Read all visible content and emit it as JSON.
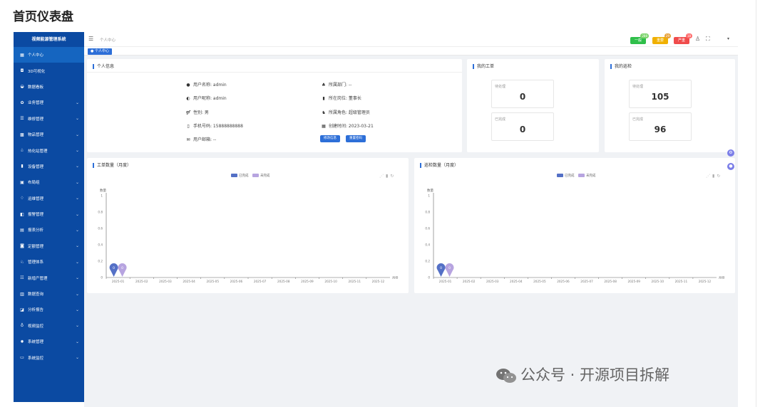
{
  "page": {
    "heading": "首页仪表盘"
  },
  "sidebar": {
    "brand": "视频能源管理系统",
    "items": [
      {
        "label": "个人中心",
        "icon": "grid-icon",
        "glyph": "▦",
        "expandable": false,
        "active": true
      },
      {
        "label": "3D可视化",
        "icon": "cube-icon",
        "glyph": "◘",
        "expandable": false,
        "active": false
      },
      {
        "label": "数据看板",
        "icon": "dashboard-icon",
        "glyph": "◒",
        "expandable": false,
        "active": false
      },
      {
        "label": "业务管理",
        "icon": "briefcase-icon",
        "glyph": "✿",
        "expandable": true,
        "active": false
      },
      {
        "label": "维修管理",
        "icon": "wrench-icon",
        "glyph": "☰",
        "expandable": true,
        "active": false
      },
      {
        "label": "物品管理",
        "icon": "box-icon",
        "glyph": "▩",
        "expandable": true,
        "active": false
      },
      {
        "label": "热化站管理",
        "icon": "station-icon",
        "glyph": "♧",
        "expandable": true,
        "active": false
      },
      {
        "label": "设备管理",
        "icon": "bar-chart-icon",
        "glyph": "▮",
        "expandable": true,
        "active": false
      },
      {
        "label": "布局组",
        "icon": "layout-icon",
        "glyph": "▣",
        "expandable": true,
        "active": false
      },
      {
        "label": "运维管理",
        "icon": "ops-icon",
        "glyph": "♢",
        "expandable": true,
        "active": false
      },
      {
        "label": "报警管理",
        "icon": "alarm-icon",
        "glyph": "◧",
        "expandable": true,
        "active": false
      },
      {
        "label": "报表分析",
        "icon": "report-icon",
        "glyph": "▤",
        "expandable": true,
        "active": false
      },
      {
        "label": "定额管理",
        "icon": "quota-icon",
        "glyph": "◙",
        "expandable": true,
        "active": false
      },
      {
        "label": "管理体系",
        "icon": "system-icon",
        "glyph": "♘",
        "expandable": true,
        "active": false
      },
      {
        "label": "新增产管理",
        "icon": "asset-icon",
        "glyph": "☷",
        "expandable": true,
        "active": false
      },
      {
        "label": "数据查询",
        "icon": "query-icon",
        "glyph": "▥",
        "expandable": true,
        "active": false
      },
      {
        "label": "分析报告",
        "icon": "analysis-icon",
        "glyph": "◪",
        "expandable": true,
        "active": false
      },
      {
        "label": "视频监控",
        "icon": "camera-icon",
        "glyph": "♁",
        "expandable": true,
        "active": false
      },
      {
        "label": "系统管理",
        "icon": "settings-icon",
        "glyph": "✹",
        "expandable": true,
        "active": false
      },
      {
        "label": "系统监控",
        "icon": "monitor-icon",
        "glyph": "▭",
        "expandable": true,
        "active": false
      }
    ]
  },
  "topbar": {
    "breadcrumb": "个人中心",
    "chips": [
      {
        "label": "一般",
        "badge": "288",
        "color": "#2fbf4a",
        "badge_color": "#7ad36a"
      },
      {
        "label": "重要",
        "badge": "29",
        "color": "#f0b000",
        "badge_color": "#e7a13a"
      },
      {
        "label": "严重",
        "badge": "18",
        "color": "#f04b4b",
        "badge_color": "#ff6b6b"
      }
    ]
  },
  "tabs": {
    "active": "个人中心"
  },
  "profile": {
    "title": "个人信息",
    "left": [
      {
        "label": "用户名称: admin",
        "icon": "user-icon",
        "glyph": "●"
      },
      {
        "label": "用户昵称: admin",
        "icon": "user-tag-icon",
        "glyph": "◐"
      },
      {
        "label": "性别: 男",
        "icon": "gender-icon",
        "glyph": "⚤"
      },
      {
        "label": "手机号码: 15888888888",
        "icon": "phone-icon",
        "glyph": "▯"
      },
      {
        "label": "用户邮箱: --",
        "icon": "mail-icon",
        "glyph": "✉"
      }
    ],
    "right": [
      {
        "label": "所属部门: --",
        "icon": "org-icon",
        "glyph": "♣"
      },
      {
        "label": "所在岗位: 董事长",
        "icon": "post-icon",
        "glyph": "▮"
      },
      {
        "label": "所属角色: 超级管理员",
        "icon": "role-icon",
        "glyph": "♞"
      },
      {
        "label": "创建时间: 2023-03-21",
        "icon": "calendar-icon",
        "glyph": "▦"
      }
    ],
    "buttons": {
      "edit": "修改信息",
      "password": "重置密码"
    }
  },
  "workorder": {
    "title": "我的工单",
    "pending_label": "待处理",
    "pending_value": "0",
    "done_label": "已完成",
    "done_value": "0"
  },
  "inspection": {
    "title": "我的巡检",
    "pending_label": "待处理",
    "pending_value": "105",
    "done_label": "已完成",
    "done_value": "96"
  },
  "chart_data": [
    {
      "type": "bar",
      "title": "工单数量（月度）",
      "ylabel": "数量",
      "xlabel": "月份",
      "ylim": [
        0,
        1
      ],
      "yticks": [
        "0",
        "0.2",
        "0.4",
        "0.6",
        "0.8",
        "1"
      ],
      "categories": [
        "2025-01",
        "2025-02",
        "2025-03",
        "2025-04",
        "2025-05",
        "2025-06",
        "2025-07",
        "2025-08",
        "2025-09",
        "2025-10",
        "2025-11",
        "2025-12"
      ],
      "series": [
        {
          "name": "已完成",
          "color": "#5470c6",
          "values": [
            0,
            0,
            0,
            0,
            0,
            0,
            0,
            0,
            0,
            0,
            0,
            0
          ]
        },
        {
          "name": "未完成",
          "color": "#b7a4e0",
          "values": [
            0,
            0,
            0,
            0,
            0,
            0,
            0,
            0,
            0,
            0,
            0,
            0
          ]
        }
      ],
      "markers": [
        "0",
        "0"
      ],
      "legend": "top-center"
    },
    {
      "type": "bar",
      "title": "巡检数量（月度）",
      "ylabel": "数量",
      "xlabel": "月份",
      "ylim": [
        0,
        1
      ],
      "yticks": [
        "0",
        "0.2",
        "0.4",
        "0.6",
        "0.8",
        "1"
      ],
      "categories": [
        "2025-01",
        "2025-02",
        "2025-03",
        "2025-04",
        "2025-05",
        "2025-06",
        "2025-07",
        "2025-08",
        "2025-09",
        "2025-10",
        "2025-11",
        "2025-12"
      ],
      "series": [
        {
          "name": "已完成",
          "color": "#5470c6",
          "values": [
            0,
            0,
            0,
            0,
            0,
            0,
            0,
            0,
            0,
            0,
            0,
            0
          ]
        },
        {
          "name": "未完成",
          "color": "#b7a4e0",
          "values": [
            0,
            0,
            0,
            0,
            0,
            0,
            0,
            0,
            0,
            0,
            0,
            0
          ]
        }
      ],
      "markers": [
        "0",
        "0"
      ],
      "legend": "top-center"
    }
  ],
  "watermark": {
    "text": "公众号 · 开源项目拆解",
    "icon": "wechat-icon"
  }
}
